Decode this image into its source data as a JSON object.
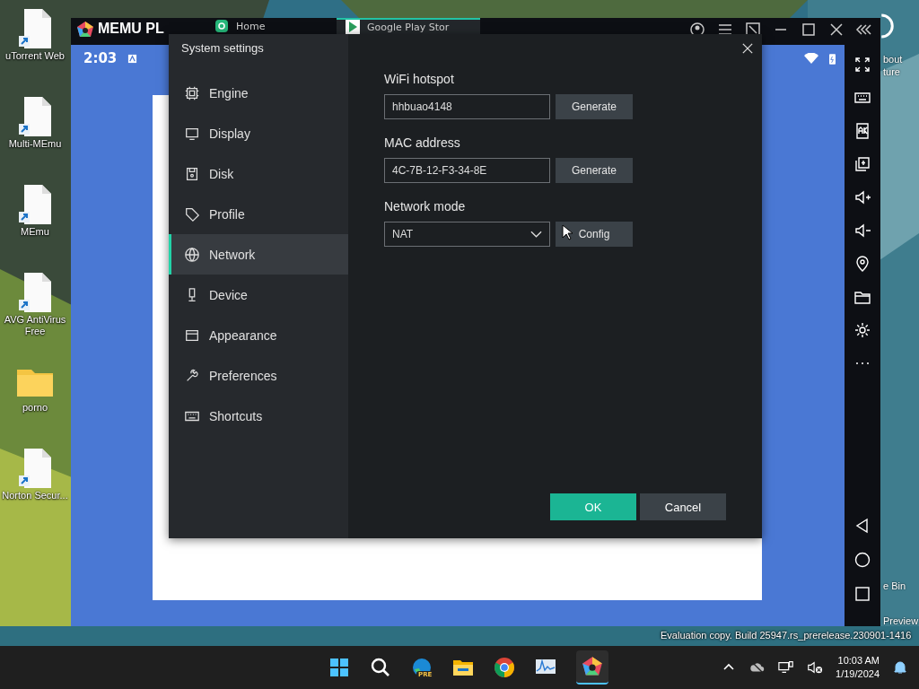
{
  "desktop_icons": [
    {
      "label": "uTorrent Web",
      "kind": "file"
    },
    {
      "label": "Multi-MEmu",
      "kind": "file"
    },
    {
      "label": "MEmu",
      "kind": "file"
    },
    {
      "label": "AVG AntiVirus Free",
      "kind": "file"
    },
    {
      "label": "porno",
      "kind": "folder"
    },
    {
      "label": "Norton Secur...",
      "kind": "file"
    }
  ],
  "desktop_partial_labels": [
    "bout",
    "ture",
    "e Bin",
    "Preview"
  ],
  "build_info": "Evaluation copy. Build 25947.rs_prerelease.230901-1416",
  "emulator": {
    "brand": "MEMU PL",
    "tabs": [
      {
        "label": "Home",
        "selected": false
      },
      {
        "label": "Google Play Stor",
        "selected": true
      }
    ],
    "clock": "2:03"
  },
  "dialog": {
    "title": "System settings",
    "nav": [
      {
        "label": "Engine",
        "selected": false
      },
      {
        "label": "Display",
        "selected": false
      },
      {
        "label": "Disk",
        "selected": false
      },
      {
        "label": "Profile",
        "selected": false
      },
      {
        "label": "Network",
        "selected": true
      },
      {
        "label": "Device",
        "selected": false
      },
      {
        "label": "Appearance",
        "selected": false
      },
      {
        "label": "Preferences",
        "selected": false
      },
      {
        "label": "Shortcuts",
        "selected": false
      }
    ],
    "fields": [
      {
        "label": "WiFi hotspot",
        "kind": "text",
        "value": "hhbuao4148",
        "button": "Generate"
      },
      {
        "label": "MAC address",
        "kind": "text",
        "value": "4C-7B-12-F3-34-8E",
        "button": "Generate"
      },
      {
        "label": "Network mode",
        "kind": "select",
        "value": "NAT",
        "button": "Config"
      }
    ],
    "ok": "OK",
    "cancel": "Cancel"
  },
  "taskbar": {
    "edge_badge": "PRE",
    "time": "10:03 AM",
    "date": "1/19/2024"
  }
}
